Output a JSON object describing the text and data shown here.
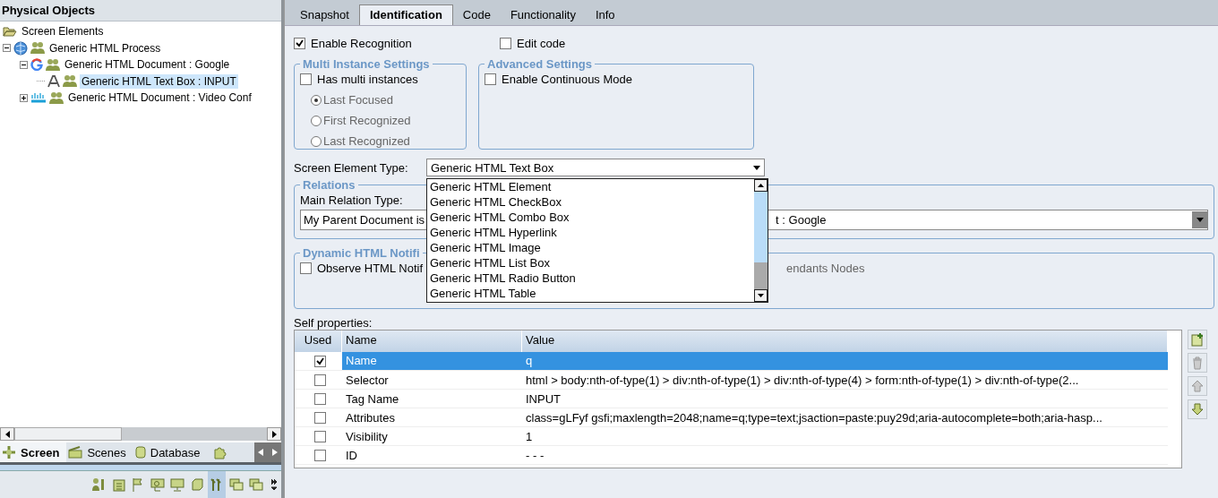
{
  "left_panel": {
    "title": "Physical Objects",
    "tree": [
      {
        "label": "Screen Elements",
        "kind": "folder",
        "expanded": true,
        "selected": false,
        "children": [
          {
            "label": "Generic HTML Process",
            "kind": "process",
            "expanded": true,
            "selected": false,
            "children": [
              {
                "label": "Generic HTML Document : Google",
                "kind": "google",
                "expanded": true,
                "selected": false,
                "children": [
                  {
                    "label": "Generic HTML Text Box : INPUT",
                    "kind": "textbox",
                    "selected": true
                  }
                ]
              },
              {
                "label": "Generic HTML Document : Video Conf",
                "kind": "cisco",
                "expanded": false,
                "selected": false
              }
            ]
          }
        ]
      }
    ],
    "bottom_tabs": [
      {
        "label": "Screen",
        "selected": true,
        "kind": "screen"
      },
      {
        "label": "Scenes",
        "selected": false,
        "kind": "scenes"
      },
      {
        "label": "Database",
        "selected": false,
        "kind": "database"
      }
    ],
    "toolbar": [
      {
        "selected": false
      },
      {
        "selected": false
      },
      {
        "selected": false
      },
      {
        "selected": false
      },
      {
        "selected": false
      },
      {
        "selected": false
      },
      {
        "selected": true
      },
      {
        "selected": false
      },
      {
        "selected": false
      }
    ]
  },
  "tabs": [
    {
      "label": "Snapshot",
      "selected": false
    },
    {
      "label": "Identification",
      "selected": true
    },
    {
      "label": "Code",
      "selected": false
    },
    {
      "label": "Functionality",
      "selected": false
    },
    {
      "label": "Info",
      "selected": false
    }
  ],
  "enable_recognition": {
    "label": "Enable Recognition",
    "checked": true
  },
  "edit_code": {
    "label": "Edit code",
    "checked": false
  },
  "multi_instance": {
    "title": "Multi Instance Settings",
    "has_multi": {
      "label": "Has multi instances",
      "checked": false
    },
    "options": [
      {
        "label": "Last Focused",
        "selected": true
      },
      {
        "label": "First Recognized",
        "selected": false
      },
      {
        "label": "Last Recognized",
        "selected": false
      }
    ]
  },
  "advanced": {
    "title": "Advanced Settings",
    "continuous": {
      "label": "Enable Continuous Mode",
      "checked": false
    }
  },
  "element_type": {
    "label": "Screen Element Type:",
    "value": "Generic HTML Text Box",
    "options": [
      "Generic HTML Element",
      "Generic HTML CheckBox",
      "Generic HTML Combo Box",
      "Generic HTML Hyperlink",
      "Generic HTML Image",
      "Generic HTML List Box",
      "Generic HTML Radio Button",
      "Generic HTML Table"
    ]
  },
  "relations": {
    "title": "Relations",
    "label": "Main Relation Type:",
    "value_start": "My Parent Document is",
    "value_end": "t : Google"
  },
  "dynamic": {
    "title": "Dynamic HTML Notifi",
    "observe": {
      "label": "Observe HTML Notif",
      "checked": false
    },
    "option_text": "endants Nodes"
  },
  "self_properties": {
    "title": "Self properties:",
    "columns": [
      "Used",
      "Name",
      "Value"
    ],
    "rows": [
      {
        "used": true,
        "name": "Name",
        "value": "q",
        "selected": true
      },
      {
        "used": false,
        "name": "Selector",
        "value": "html > body:nth-of-type(1) > div:nth-of-type(1) > div:nth-of-type(4) > form:nth-of-type(1) > div:nth-of-type(2...",
        "selected": false
      },
      {
        "used": false,
        "name": "Tag Name",
        "value": "INPUT",
        "selected": false
      },
      {
        "used": false,
        "name": "Attributes",
        "value": "class=gLFyf gsfi;maxlength=2048;name=q;type=text;jsaction=paste:puy29d;aria-autocomplete=both;aria-hasp...",
        "selected": false
      },
      {
        "used": false,
        "name": "Visibility",
        "value": "1",
        "selected": false
      },
      {
        "used": false,
        "name": "ID",
        "value": "- - -",
        "selected": false
      }
    ]
  }
}
